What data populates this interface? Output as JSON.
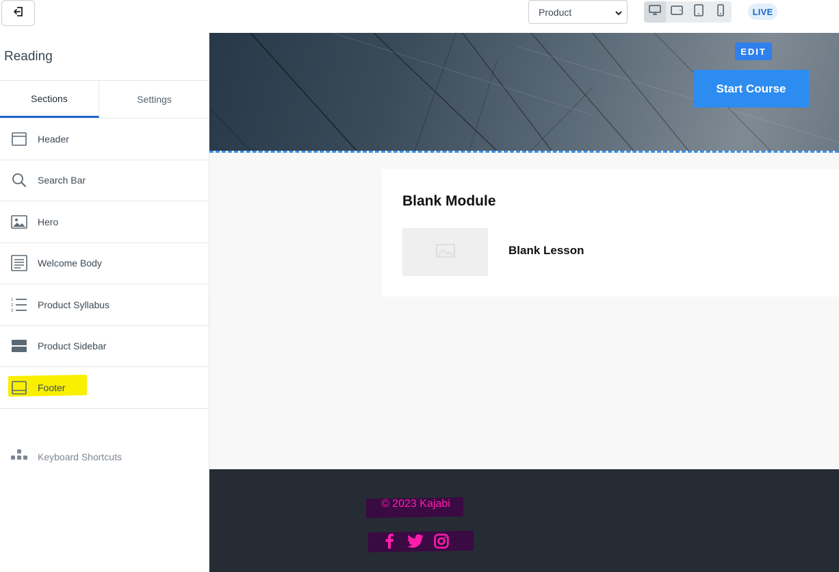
{
  "topbar": {
    "exit_icon": "exit-icon",
    "page_select": {
      "value": "Product"
    },
    "devices": [
      "desktop-icon",
      "tablet-landscape-icon",
      "tablet-portrait-icon",
      "mobile-icon"
    ],
    "status": "LIVE"
  },
  "sidebar": {
    "title": "Reading",
    "tabs": [
      {
        "label": "Sections",
        "active": true
      },
      {
        "label": "Settings",
        "active": false
      }
    ],
    "items": [
      {
        "label": "Header",
        "icon": "header-icon"
      },
      {
        "label": "Search Bar",
        "icon": "search-icon"
      },
      {
        "label": "Hero",
        "icon": "image-icon"
      },
      {
        "label": "Welcome Body",
        "icon": "text-block-icon"
      },
      {
        "label": "Product Syllabus",
        "icon": "numbered-list-icon"
      },
      {
        "label": "Product Sidebar",
        "icon": "sidebar-layout-icon"
      },
      {
        "label": "Footer",
        "icon": "footer-icon",
        "highlighted": true
      }
    ],
    "shortcuts": {
      "label": "Keyboard Shortcuts",
      "icon": "keyboard-icon"
    }
  },
  "preview": {
    "hero": {
      "edit_label": "EDIT",
      "cta": "Start Course"
    },
    "module": {
      "title": "Blank Module",
      "lesson": "Blank Lesson"
    },
    "footer": {
      "copyright": "© 2023 Kajabi",
      "social": [
        "facebook-icon",
        "twitter-icon",
        "instagram-icon"
      ]
    }
  },
  "colors": {
    "accent": "#2d8cf0",
    "highlight": "#f8f000",
    "footer_bg": "#262c34",
    "footer_text": "#ff1dac",
    "footer_mark": "#3a0a43"
  }
}
